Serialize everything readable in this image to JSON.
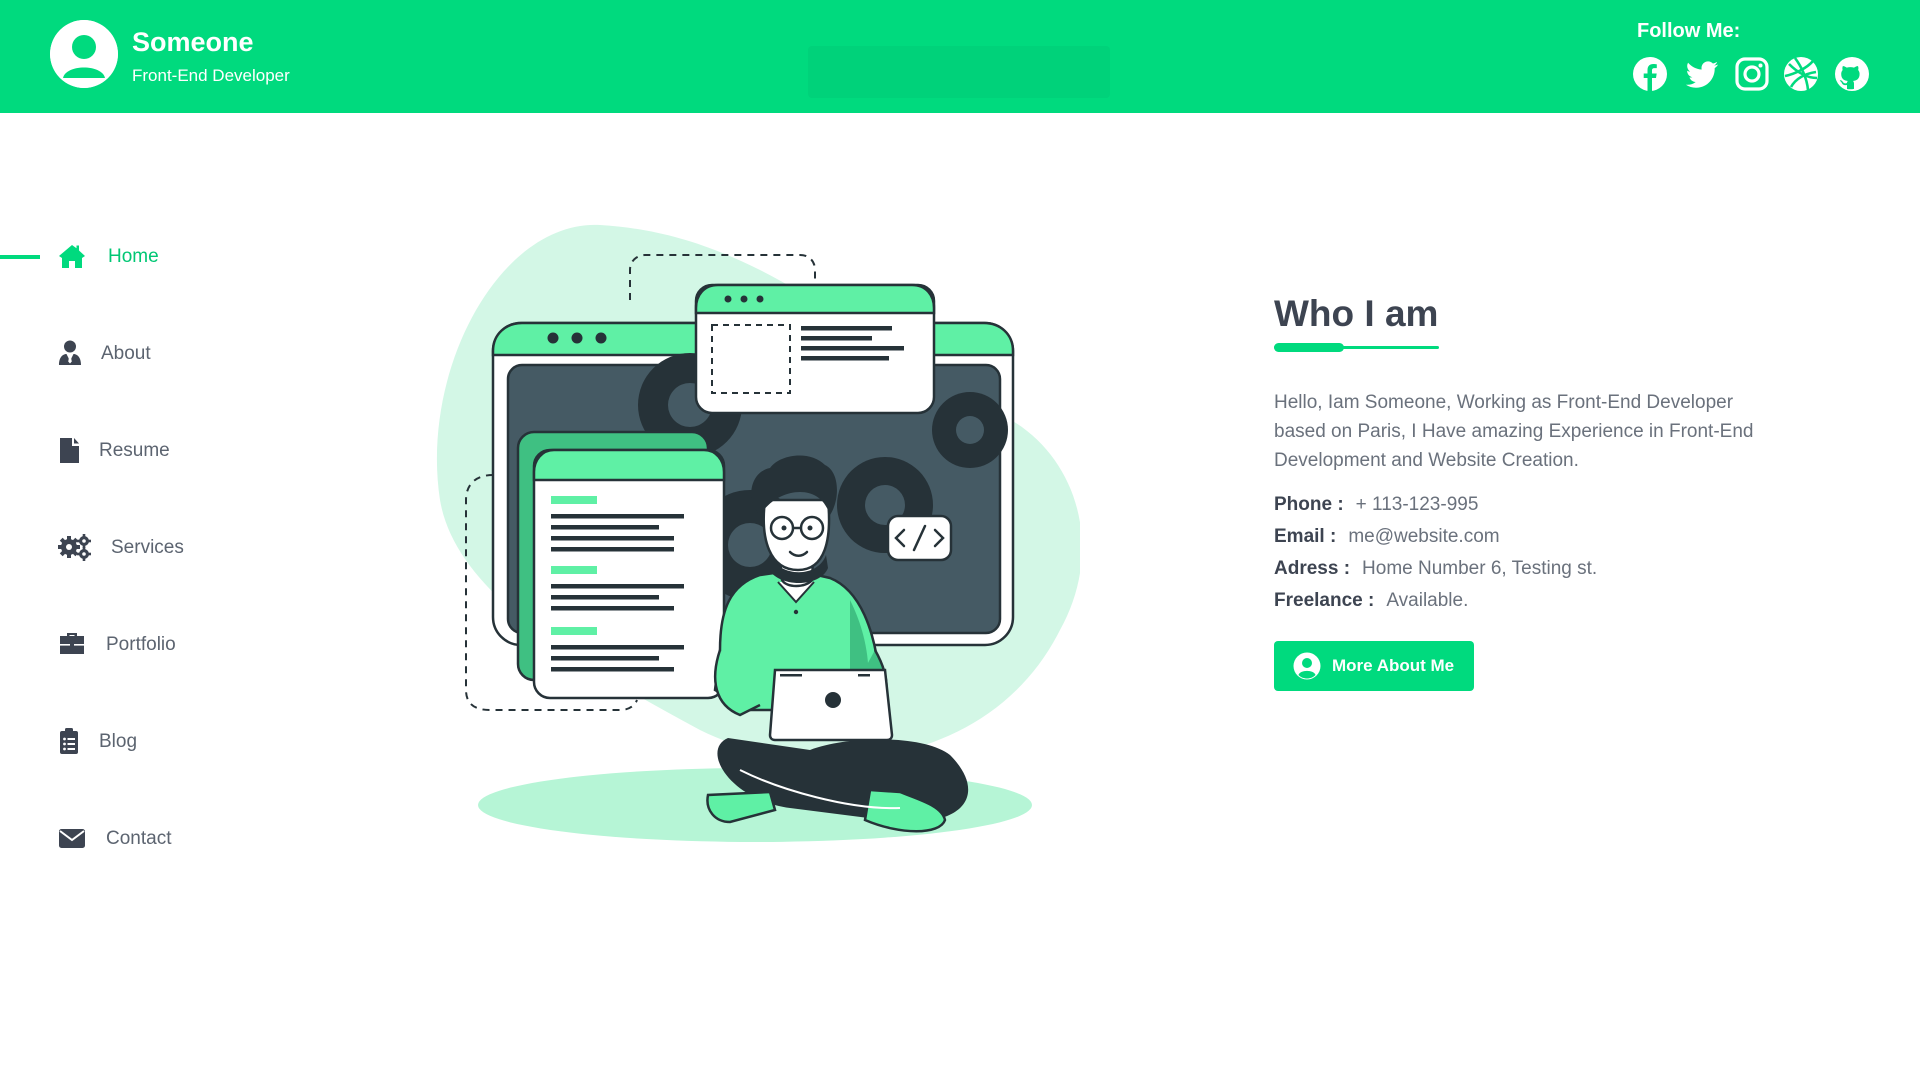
{
  "header": {
    "name": "Someone",
    "role": "Front-End Developer",
    "follow_label": "Follow Me:",
    "social": [
      {
        "icon": "facebook-icon"
      },
      {
        "icon": "twitter-icon"
      },
      {
        "icon": "instagram-icon"
      },
      {
        "icon": "dribbble-icon"
      },
      {
        "icon": "github-icon"
      }
    ]
  },
  "nav": {
    "items": [
      {
        "label": "Home",
        "icon": "home-icon",
        "active": true
      },
      {
        "label": "About",
        "icon": "user-tie-icon",
        "active": false
      },
      {
        "label": "Resume",
        "icon": "file-icon",
        "active": false
      },
      {
        "label": "Services",
        "icon": "gears-icon",
        "active": false
      },
      {
        "label": "Portfolio",
        "icon": "briefcase-icon",
        "active": false
      },
      {
        "label": "Blog",
        "icon": "clipboard-list-icon",
        "active": false
      },
      {
        "label": "Contact",
        "icon": "envelope-icon",
        "active": false
      }
    ]
  },
  "about": {
    "title": "Who I am",
    "bio": "Hello, Iam Someone, Working as Front-End Developer based on Paris, I Have amazing Experience in Front-End Development and Website Creation.",
    "info": [
      {
        "key": "Phone :",
        "value": "+ 113-123-995"
      },
      {
        "key": "Email :",
        "value": "me@website.com"
      },
      {
        "key": "Adress :",
        "value": "Home Number 6, Testing st."
      },
      {
        "key": "Freelance :",
        "value": "Available."
      }
    ],
    "cta_label": "More About Me"
  },
  "colors": {
    "accent": "#00da7e",
    "text_dark": "#3d4451",
    "text_muted": "#6a717c",
    "illustration_dark": "#263238"
  }
}
